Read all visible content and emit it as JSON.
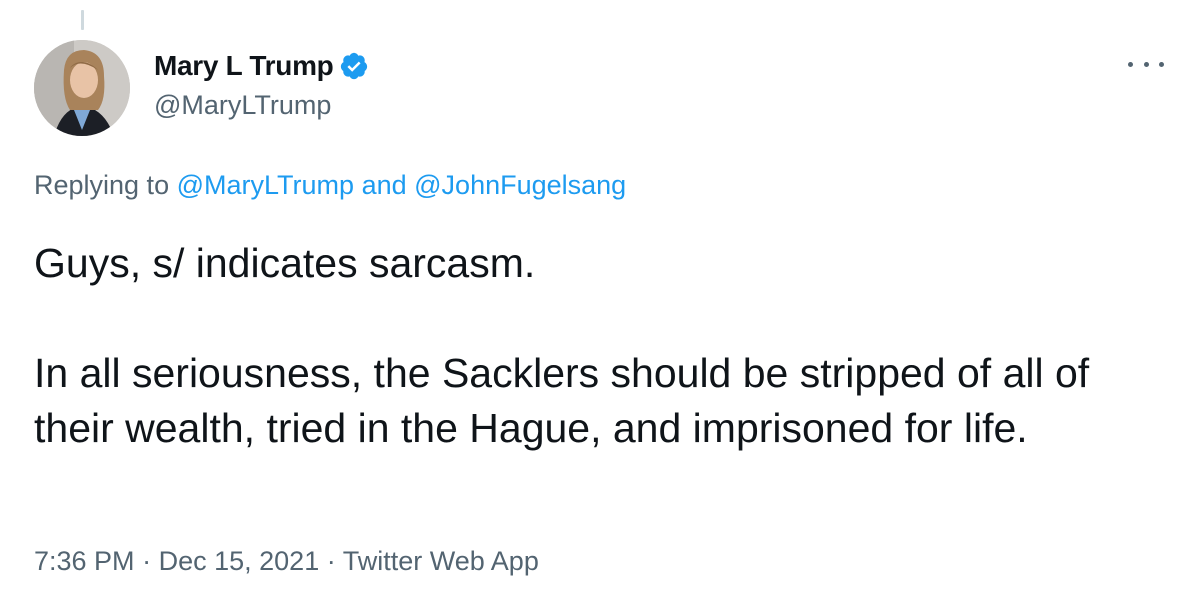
{
  "author": {
    "display_name": "Mary L Trump",
    "handle": "@MaryLTrump",
    "verified_icon": "verified-badge-icon",
    "accent_color": "#1d9bf0"
  },
  "replying": {
    "prefix": "Replying to",
    "mention_1": "@MaryLTrump",
    "joiner": "and",
    "mention_2": "@JohnFugelsang"
  },
  "tweet": {
    "line_1": "Guys, s/ indicates sarcasm.",
    "paragraph_2": "In all seriousness, the Sacklers should be stripped of all of their wealth, tried in the Hague, and imprisoned for life."
  },
  "meta": {
    "time": "7:36 PM",
    "separator": "·",
    "date": "Dec 15, 2021",
    "source": "Twitter Web App"
  },
  "more_menu_icon": "more-horizontal-icon"
}
